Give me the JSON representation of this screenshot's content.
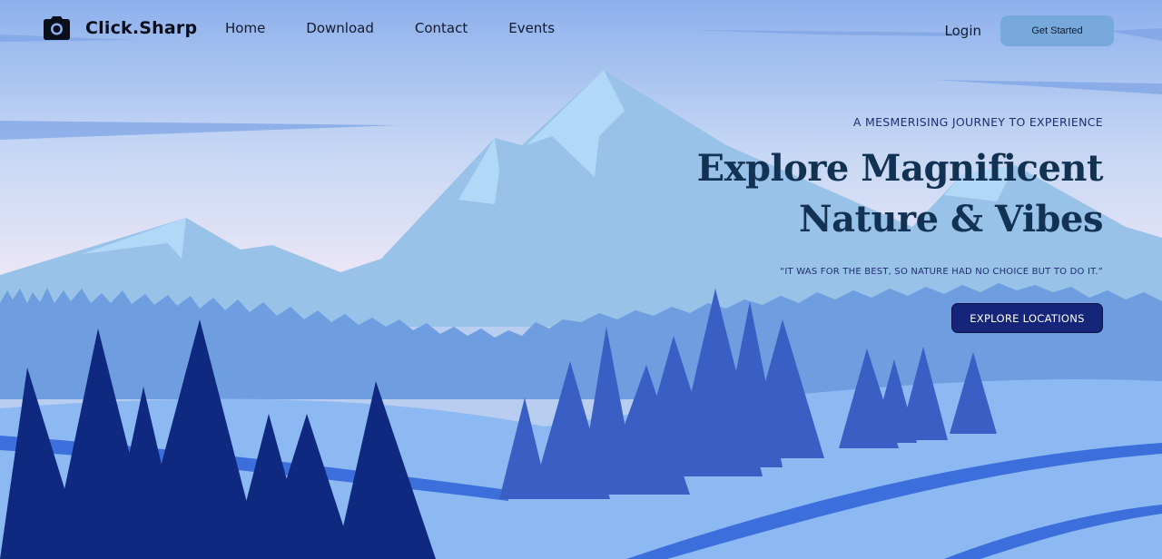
{
  "brand": {
    "name": "Click.Sharp",
    "icon": "camera-icon"
  },
  "nav": {
    "links": [
      {
        "label": "Home"
      },
      {
        "label": "Download"
      },
      {
        "label": "Contact"
      },
      {
        "label": "Events"
      }
    ],
    "login_label": "Login",
    "cta_label": "Get Started"
  },
  "hero": {
    "eyebrow": "A MESMERISING JOURNEY TO EXPERIENCE",
    "title_line1": "Explore Magnificent",
    "title_line2": "Nature & Vibes",
    "quote": "“IT WAS FOR THE BEST, SO NATURE HAD NO CHOICE BUT TO DO IT.”",
    "cta_label": "EXPLORE LOCATIONS"
  },
  "colors": {
    "sky_top": "#8db0ec",
    "sky_bottom": "#efe8f6",
    "mountain": "#99c2e8",
    "snow": "#b2d8f8",
    "far_forest": "#6e9ee0",
    "snow_ground": "#8db9f2",
    "river": "#3c6fdc",
    "mid_trees": "#3a5fc4",
    "front_trees": "#0f2880",
    "cta_primary": "#14257a",
    "cta_secondary": "#78a9dc",
    "heading": "#123253"
  }
}
